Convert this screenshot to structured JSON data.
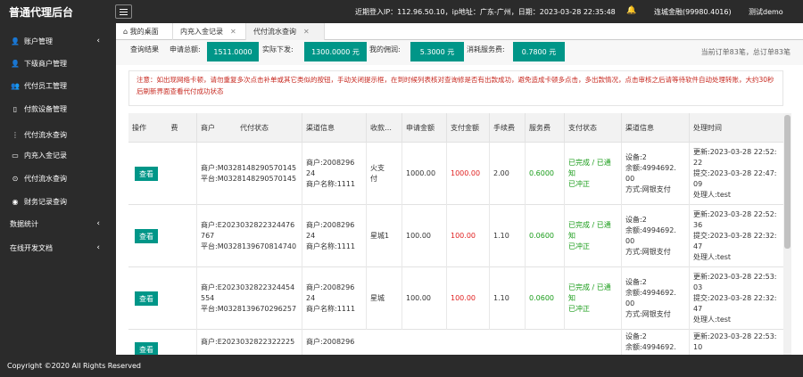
{
  "header": {
    "brand": "普通代理后台",
    "recent_login": "近期登入IP：112.96.50.10，ip地址：广东-广州，日期：2023-03-28 22:35:48",
    "user": "连城金融(99980.4016)",
    "login_name": "测试demo"
  },
  "sidebar": {
    "items": [
      {
        "label": "账户管理",
        "icon": "user-icon",
        "chevron": "‹"
      },
      {
        "label": "下级商户管理",
        "icon": "user-icon",
        "chevron": ""
      },
      {
        "label": "代付员工管理",
        "icon": "people-icon",
        "chevron": ""
      },
      {
        "label": "付款设备管理",
        "icon": "device-icon",
        "chevron": ""
      },
      {
        "label": "代付流水查询",
        "icon": "list-icon",
        "chevron": ""
      },
      {
        "label": "内充入金记录",
        "icon": "record-icon",
        "chevron": ""
      },
      {
        "label": "代付流水查询",
        "icon": "search-icon",
        "chevron": ""
      },
      {
        "label": "财务记录查询",
        "icon": "finance-icon",
        "chevron": ""
      },
      {
        "label": "数据统计",
        "icon": "",
        "chevron": "‹"
      },
      {
        "label": "在线开发文档",
        "icon": "",
        "chevron": "‹"
      }
    ]
  },
  "tabs": [
    {
      "label": "我的桌面",
      "icon": "home-icon",
      "close": ""
    },
    {
      "label": "内充入金记录",
      "icon": "",
      "close": "✕"
    },
    {
      "label": "代付流水查询",
      "icon": "",
      "close": "✕"
    }
  ],
  "stats": {
    "title": "查询结果",
    "apply_label": "申请总额:",
    "apply_value": "1511.0000",
    "actual_label": "实际下发:",
    "actual_value": "1300.0000 元",
    "fee_label": "我的佣润:",
    "fee_value": "5.3000 元",
    "service_label": "消耗服务费:",
    "service_value": "0.7800 元",
    "summary": "当前订单83笔，总订单83笔"
  },
  "notice": "注意：如出现网络卡顿，请勿重复多次点击补单或其它类似的按钮，手动关闭提示框，在到时候列表核对查询修是否有出款成功，避免造成卡顿多点击，多出款情况，点击审核之后请等待软件自动处理转账，大约30秒后刷新界面查看代付成功状态",
  "table": {
    "headers": [
      "操作",
      "费",
      "商户",
      "代付状态",
      "渠道信息",
      "收款…",
      "申请金额",
      "支付金额",
      "手续费",
      "服务费",
      "支付状态",
      "渠道信息",
      "处理时间"
    ],
    "view_label": "查看",
    "rows": [
      {
        "merchant": "商户:M0328148290570145\n平台:M0328148290570145",
        "channel": "商户:2008296\n24\n商户名称:1111",
        "payee": "火支\n付",
        "apply": "1000.00",
        "pay": "1000.00",
        "fee": "2.00",
        "service": "0.6000",
        "status": "已完成 / 已通\n知\n已冲正",
        "device": "设备:2\n余额:4994692.\n00\n方式:网银支付",
        "time": "更新:2023-03-28 22:52:\n22\n提交:2023-03-28 22:47:\n09\n处理人:test"
      },
      {
        "merchant": "商户:E2023032822324476\n767\n平台:M0328139670814740",
        "channel": "商户:2008296\n24\n商户名称:1111",
        "payee": "星城1",
        "apply": "100.00",
        "pay": "100.00",
        "fee": "1.10",
        "service": "0.0600",
        "status": "已完成 / 已通\n知\n已冲正",
        "device": "设备:2\n余额:4994692.\n00\n方式:网银支付",
        "time": "更新:2023-03-28 22:52:\n36\n提交:2023-03-28 22:32:\n47\n处理人:test"
      },
      {
        "merchant": "商户:E2023032822324454\n554\n平台:M0328139670296257",
        "channel": "商户:2008296\n24\n商户名称:1111",
        "payee": "星城",
        "apply": "100.00",
        "pay": "100.00",
        "fee": "1.10",
        "service": "0.0600",
        "status": "已完成 / 已通\n知\n已冲正",
        "device": "设备:2\n余额:4994692.\n00\n方式:网银支付",
        "time": "更新:2023-03-28 22:53:\n03\n提交:2023-03-28 22:32:\n47\n处理人:test"
      },
      {
        "merchant": "商户:E2023032822322225",
        "channel": "商户:2008296",
        "payee": "",
        "apply": "",
        "pay": "",
        "fee": "",
        "service": "",
        "status": "",
        "device": "设备:2\n余额:4994692.",
        "time": "更新:2023-03-28 22:53:\n10"
      }
    ]
  },
  "footer": "Copyright ©2020 All Rights Reserved",
  "colors": {
    "accent": "#009688",
    "dark": "#2b2b2b",
    "red": "#e02020",
    "green": "#1a9c1a"
  }
}
